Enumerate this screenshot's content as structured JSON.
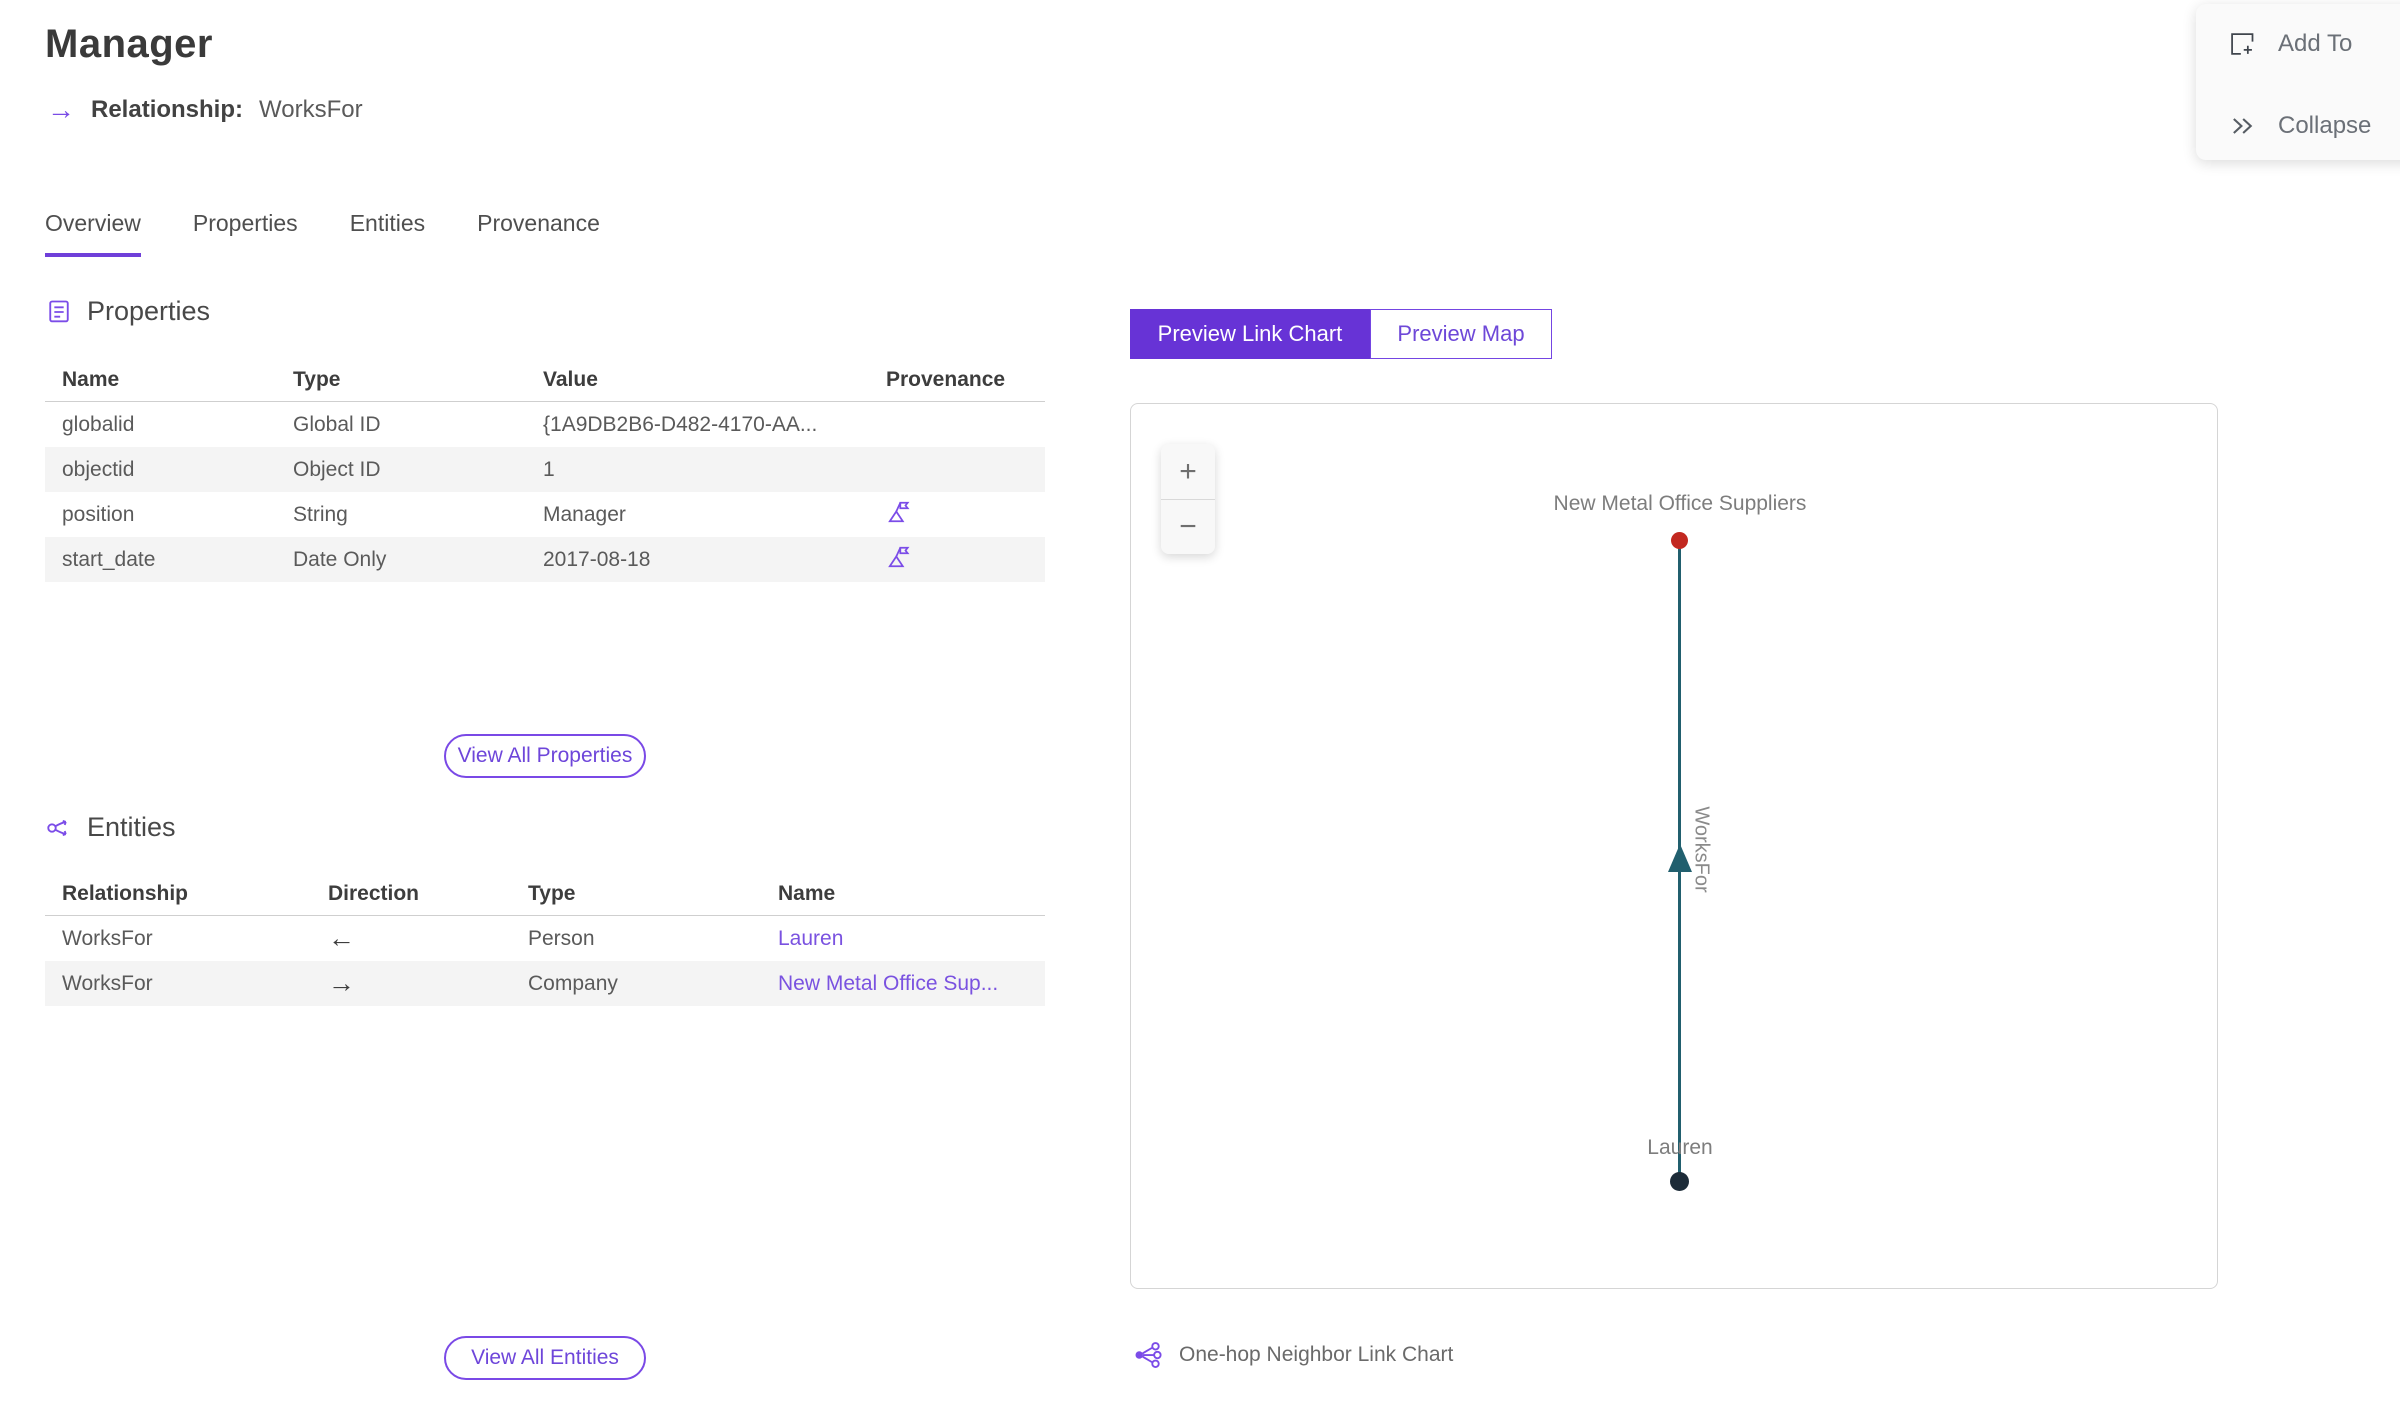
{
  "header": {
    "title": "Manager",
    "arrow": "→",
    "subtitle_label": "Relationship:",
    "subtitle_value": "WorksFor"
  },
  "actions": {
    "add_to": "Add To",
    "collapse": "Collapse"
  },
  "tabs": [
    {
      "label": "Overview",
      "active": true
    },
    {
      "label": "Properties",
      "active": false
    },
    {
      "label": "Entities",
      "active": false
    },
    {
      "label": "Provenance",
      "active": false
    }
  ],
  "properties_section": {
    "title": "Properties",
    "columns": [
      "Name",
      "Type",
      "Value",
      "Provenance"
    ],
    "rows": [
      {
        "name": "globalid",
        "type": "Global ID",
        "value": "{1A9DB2B6-D482-4170-AA...",
        "has_provenance": false
      },
      {
        "name": "objectid",
        "type": "Object ID",
        "value": "1",
        "has_provenance": false
      },
      {
        "name": "position",
        "type": "String",
        "value": "Manager",
        "has_provenance": true
      },
      {
        "name": "start_date",
        "type": "Date Only",
        "value": "2017-08-18",
        "has_provenance": true
      }
    ],
    "view_all_label": "View All Properties"
  },
  "entities_section": {
    "title": "Entities",
    "columns": [
      "Relationship",
      "Direction",
      "Type",
      "Name"
    ],
    "rows": [
      {
        "relationship": "WorksFor",
        "direction": "←",
        "type": "Person",
        "name": "Lauren"
      },
      {
        "relationship": "WorksFor",
        "direction": "→",
        "type": "Company",
        "name": "New Metal Office Sup..."
      }
    ],
    "view_all_label": "View All Entities"
  },
  "preview": {
    "toggle": [
      {
        "label": "Preview Link Chart",
        "active": true
      },
      {
        "label": "Preview Map",
        "active": false
      }
    ],
    "zoom_in": "+",
    "zoom_out": "−",
    "caption": "One-hop Neighbor Link Chart"
  },
  "chart_data": {
    "type": "link-chart",
    "nodes": [
      {
        "id": "company",
        "label": "New Metal Office Suppliers",
        "color": "#c22820"
      },
      {
        "id": "person",
        "label": "Lauren",
        "color": "#1c2b38"
      }
    ],
    "edges": [
      {
        "label": "WorksFor",
        "source": "Lauren",
        "target": "New Metal Office Suppliers",
        "color": "#215f6e",
        "arrow_direction": "up"
      }
    ]
  },
  "colors": {
    "accent_purple": "#6f3fd9",
    "link_purple": "#7a52e0",
    "toggle_active_bg": "#6733d6",
    "edge_teal": "#215f6e",
    "node_red": "#c22820",
    "node_dark": "#1c2b38",
    "row_alt_bg": "#f4f4f4"
  }
}
